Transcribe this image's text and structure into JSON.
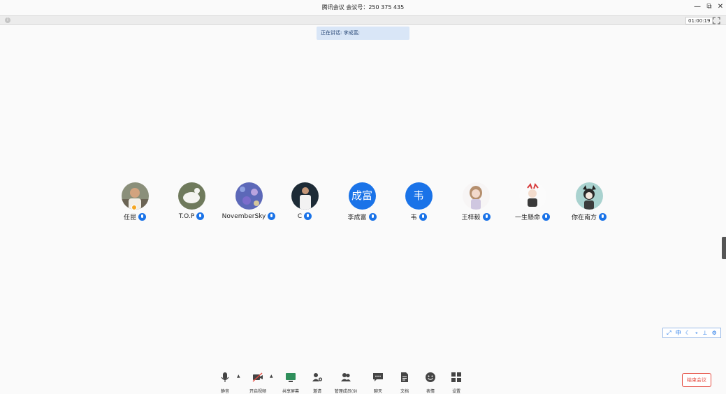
{
  "window": {
    "title": "腾讯会议 会议号：250 375 435",
    "minimize_icon": "—",
    "restore_icon": "⧉",
    "close_icon": "✕"
  },
  "topbar": {
    "timer": "01:00:19"
  },
  "speaking": {
    "text": "正在讲话: 李成富;"
  },
  "participants": [
    {
      "name": "任昆",
      "avatar": "photo",
      "host": true
    },
    {
      "name": "T.O.P",
      "avatar": "photo"
    },
    {
      "name": "NovemberSky",
      "avatar": "photo"
    },
    {
      "name": "C",
      "avatar": "photo"
    },
    {
      "name": "李成富",
      "avatar": "text",
      "avatar_text": "成富"
    },
    {
      "name": "韦",
      "avatar": "text",
      "avatar_text": "韦"
    },
    {
      "name": "王梓毅",
      "avatar": "photo"
    },
    {
      "name": "一生懸命",
      "avatar": "photo"
    },
    {
      "name": "你在南方",
      "avatar": "photo"
    }
  ],
  "toolbox": {
    "items": [
      "⤢",
      "中",
      "☾",
      "∘",
      "⊥",
      "⚙"
    ]
  },
  "toolbar": {
    "mute": "静音",
    "video": "开启视频",
    "share": "共享屏幕",
    "invite": "邀请",
    "members": "管理成员(9)",
    "chat": "聊天",
    "docs": "文档",
    "emoji": "表情",
    "settings": "设置",
    "end": "结束会议"
  },
  "colors": {
    "accent": "#1a73e8",
    "end_red": "#e54d42"
  }
}
